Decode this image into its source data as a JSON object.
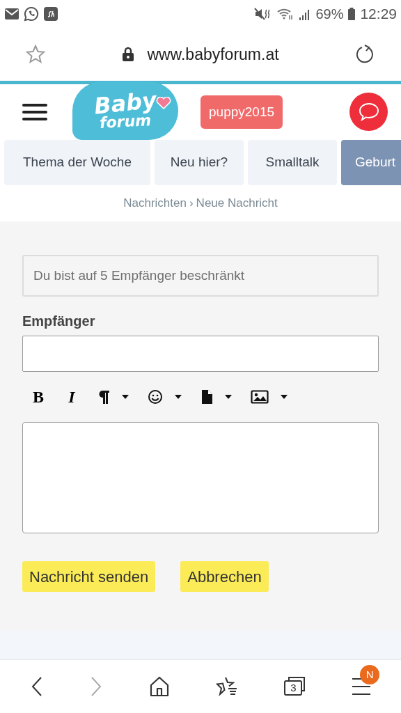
{
  "status_bar": {
    "battery": "69%",
    "time": "12:29"
  },
  "address_bar": {
    "url": "www.babyforum.at"
  },
  "header": {
    "logo": {
      "line_1": "Baby",
      "line_2": "forum"
    },
    "user": "puppy2015"
  },
  "nav_tabs": [
    {
      "label": "Thema der Woche",
      "selected": false
    },
    {
      "label": "Neu hier?",
      "selected": false
    },
    {
      "label": "Smalltalk",
      "selected": false
    },
    {
      "label": "Geburt",
      "selected": true
    }
  ],
  "breadcrumb": {
    "parent": "Nachrichten",
    "separator": "›",
    "current": "Neue Nachricht"
  },
  "form": {
    "notice": "Du bist auf 5 Empfänger beschränkt",
    "recipient_label": "Empfänger",
    "toolbar": [
      {
        "kind": "bold",
        "label": "B"
      },
      {
        "kind": "italic",
        "label": "I"
      },
      {
        "kind": "paragraph"
      },
      {
        "kind": "emoji"
      },
      {
        "kind": "file"
      },
      {
        "kind": "image"
      }
    ],
    "buttons": [
      "Nachricht senden",
      "Abbrechen"
    ]
  },
  "browser_nav": {
    "back_disabled": false,
    "forward_disabled": true,
    "tab_count": "3",
    "menu_badge": "N"
  }
}
